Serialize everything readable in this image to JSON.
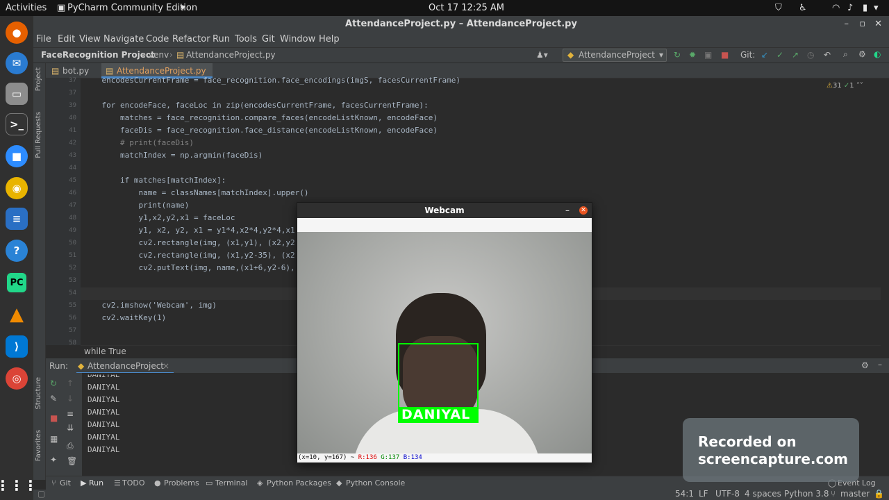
{
  "topbar": {
    "activities": "Activities",
    "app": "PyCharm Community Edition",
    "clock": "Oct 17  12:25 AM"
  },
  "window": {
    "title": "AttendanceProject.py – AttendanceProject.py"
  },
  "menu": [
    "File",
    "Edit",
    "View",
    "Navigate",
    "Code",
    "Refactor",
    "Run",
    "Tools",
    "Git",
    "Window",
    "Help"
  ],
  "nav": {
    "project": "FaceRecognition Project",
    "venv": "venv",
    "file": "AttendanceProject.py",
    "run_config": "AttendanceProject",
    "git": "Git:"
  },
  "tabs": [
    {
      "label": "bot.py"
    },
    {
      "label": "AttendanceProject.py"
    }
  ],
  "left_strip": {
    "project": "Project",
    "pull": "Pull Requests",
    "structure": "Structure",
    "favorites": "Favorites"
  },
  "inspection": {
    "warnings": "31",
    "errors": "1"
  },
  "code_lines": [
    {
      "n": "37",
      "t": "    encodesCurrentFrame = face_recognition.face_encodings(imgS, facesCurrentFrame)"
    },
    {
      "n": "38",
      "t": ""
    },
    {
      "n": "39",
      "t": "    for encodeFace, faceLoc in zip(encodesCurrentFrame, facesCurrentFrame):"
    },
    {
      "n": "40",
      "t": "        matches = face_recognition.compare_faces(encodeListKnown, encodeFace)"
    },
    {
      "n": "41",
      "t": "        faceDis = face_recognition.face_distance(encodeListKnown, encodeFace)"
    },
    {
      "n": "42",
      "t": "        # print(faceDis)"
    },
    {
      "n": "43",
      "t": "        matchIndex = np.argmin(faceDis)"
    },
    {
      "n": "44",
      "t": ""
    },
    {
      "n": "45",
      "t": "        if matches[matchIndex]:"
    },
    {
      "n": "46",
      "t": "            name = classNames[matchIndex].upper()"
    },
    {
      "n": "47",
      "t": "            print(name)"
    },
    {
      "n": "48",
      "t": "            y1,x2,y2,x1 = faceLoc"
    },
    {
      "n": "49",
      "t": "            y1, x2, y2, x1 = y1*4,x2*4,y2*4,x1"
    },
    {
      "n": "50",
      "t": "            cv2.rectangle(img, (x1,y1), (x2,y2"
    },
    {
      "n": "51",
      "t": "            cv2.rectangle(img, (x1,y2-35), (x2"
    },
    {
      "n": "52",
      "t": "            cv2.putText(img, name,(x1+6,y2-6),"
    },
    {
      "n": "53",
      "t": ""
    },
    {
      "n": "54",
      "t": ""
    },
    {
      "n": "55",
      "t": "    cv2.imshow('Webcam', img)"
    },
    {
      "n": "56",
      "t": "    cv2.waitKey(1)"
    },
    {
      "n": "57",
      "t": ""
    },
    {
      "n": "58",
      "t": ""
    }
  ],
  "breadcrumb": "while True",
  "run": {
    "label": "Run:",
    "config": "AttendanceProject",
    "output": [
      "DANIYAL",
      "DANIYAL",
      "DANIYAL",
      "DANIYAL",
      "DANIYAL",
      "DANIYAL",
      "DANIYAL"
    ]
  },
  "webcam": {
    "title": "Webcam",
    "label": "DANIYAL",
    "status_pos": "(x=10, y=167) ~ ",
    "r": "R:136",
    "g": "G:137",
    "b": "B:134"
  },
  "bottom_tabs": [
    "Git",
    "Run",
    "TODO",
    "Problems",
    "Terminal",
    "Python Packages",
    "Python Console"
  ],
  "event_log": "Event Log",
  "status": {
    "pos": "54:1",
    "lf": "LF",
    "enc": "UTF-8",
    "indent": "4 spaces",
    "py": "Python 3.8",
    "branch": "master"
  },
  "watermark": {
    "line1": "Recorded on",
    "line2": "screencapture.com"
  }
}
